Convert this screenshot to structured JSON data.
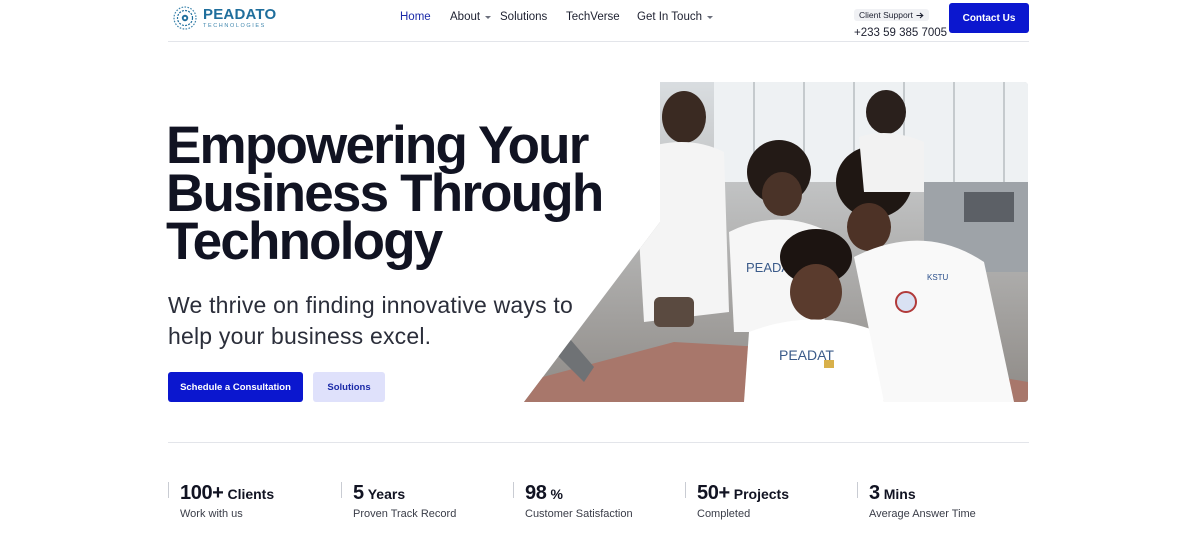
{
  "brand": {
    "name": "PEADATO",
    "tagline": "TECHNOLOGIES"
  },
  "nav": {
    "items": [
      {
        "label": "Home",
        "active": true,
        "has_dropdown": false
      },
      {
        "label": "About",
        "active": false,
        "has_dropdown": true
      },
      {
        "label": "Solutions",
        "active": false,
        "has_dropdown": false
      },
      {
        "label": "TechVerse",
        "active": false,
        "has_dropdown": false
      },
      {
        "label": "Get In Touch",
        "active": false,
        "has_dropdown": true
      }
    ]
  },
  "support": {
    "label": "Client Support",
    "phone": "+233 59 385 7005"
  },
  "header": {
    "contact_label": "Contact Us"
  },
  "hero": {
    "title_lines": [
      "Empowering Your",
      "Business Through",
      "Technology"
    ],
    "subtitle": "We thrive on finding innovative ways to help your business excel.",
    "primary_cta": "Schedule a Consultation",
    "secondary_cta": "Solutions"
  },
  "stats": [
    {
      "value": "100+",
      "unit": "Clients",
      "description": "Work with us"
    },
    {
      "value": "5",
      "unit": "Years",
      "description": "Proven Track Record"
    },
    {
      "value": "98",
      "unit": "%",
      "description": "Customer Satisfaction"
    },
    {
      "value": "50+",
      "unit": "Projects",
      "description": "Completed"
    },
    {
      "value": "3",
      "unit": "Mins",
      "description": "Average Answer Time"
    }
  ],
  "colors": {
    "accent": "#0b17cf",
    "accent_soft": "#dfe1fb",
    "nav_active": "#1b2aa8",
    "heading": "#111322",
    "logo": "#1f6e9c"
  }
}
